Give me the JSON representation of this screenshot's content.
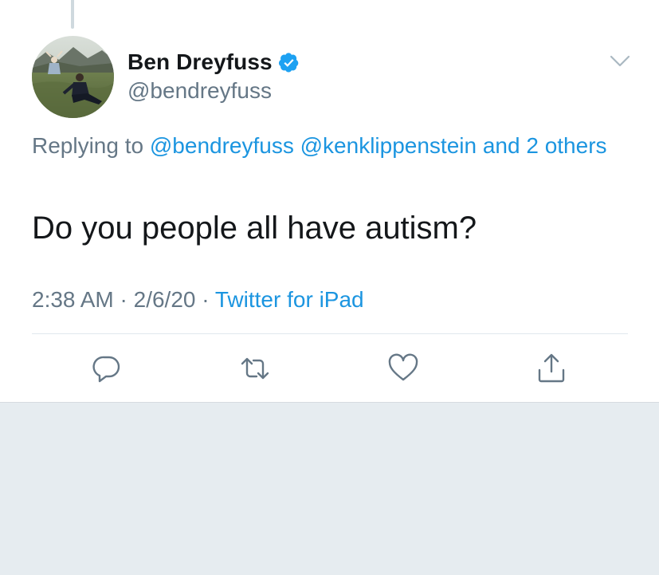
{
  "tweet": {
    "display_name": "Ben Dreyfuss",
    "handle": "@bendreyfuss",
    "verified": true,
    "replying_prefix": "Replying to ",
    "replying_handle_1": "@bendreyfuss",
    "replying_handle_2": "@kenklippenstein",
    "replying_others": "and 2 others",
    "text": "Do you people all have autism?",
    "time": "2:38 AM",
    "date": "2/6/20",
    "separator": "·",
    "source": "Twitter for iPad"
  },
  "icons": {
    "menu": "chevron-down-icon",
    "verified": "verified-badge-icon",
    "reply": "reply-icon",
    "retweet": "retweet-icon",
    "like": "like-icon",
    "share": "share-icon"
  },
  "colors": {
    "link": "#1b95e0",
    "muted": "#657786",
    "text": "#14171a",
    "background": "#e6ecf0",
    "card": "#ffffff"
  }
}
